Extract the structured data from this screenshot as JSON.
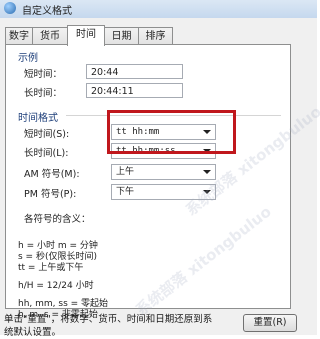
{
  "window": {
    "title": "自定义格式"
  },
  "tabs": [
    "数字",
    "货币",
    "时间",
    "日期",
    "排序"
  ],
  "active_tab": "时间",
  "example": {
    "group_label": "示例",
    "short_time_label": "短时间：",
    "short_time_value": "20:44",
    "long_time_label": "长时间：",
    "long_time_value": "20:44:11"
  },
  "time_formats": {
    "group_label": "时间格式",
    "short_time_label": "短时间(S):",
    "short_time_value": "tt hh:mm",
    "long_time_label": "长时间(L):",
    "long_time_value": "tt hh:mm:ss",
    "am_label": "AM 符号(M):",
    "am_value": "上午",
    "pm_label": "PM 符号(P):",
    "pm_value": "下午"
  },
  "notes": {
    "title": "各符号的含义：",
    "lines": [
      "h = 小时    m = 分钟",
      "s = 秒(仅限长时间)",
      "tt = 上午或下午",
      "h/H = 12/24 小时",
      "hh, mm, ss = 零起始",
      "h, m, s = 非零起始"
    ]
  },
  "footer": {
    "text": "单击\"重置\"，将数字、货币、时间和日期还原到系统默认设置。",
    "reset_label": "重置(R)"
  },
  "colors": {
    "highlight": "#c0171d"
  },
  "watermark": "系统部落 xitongbuluo.com"
}
